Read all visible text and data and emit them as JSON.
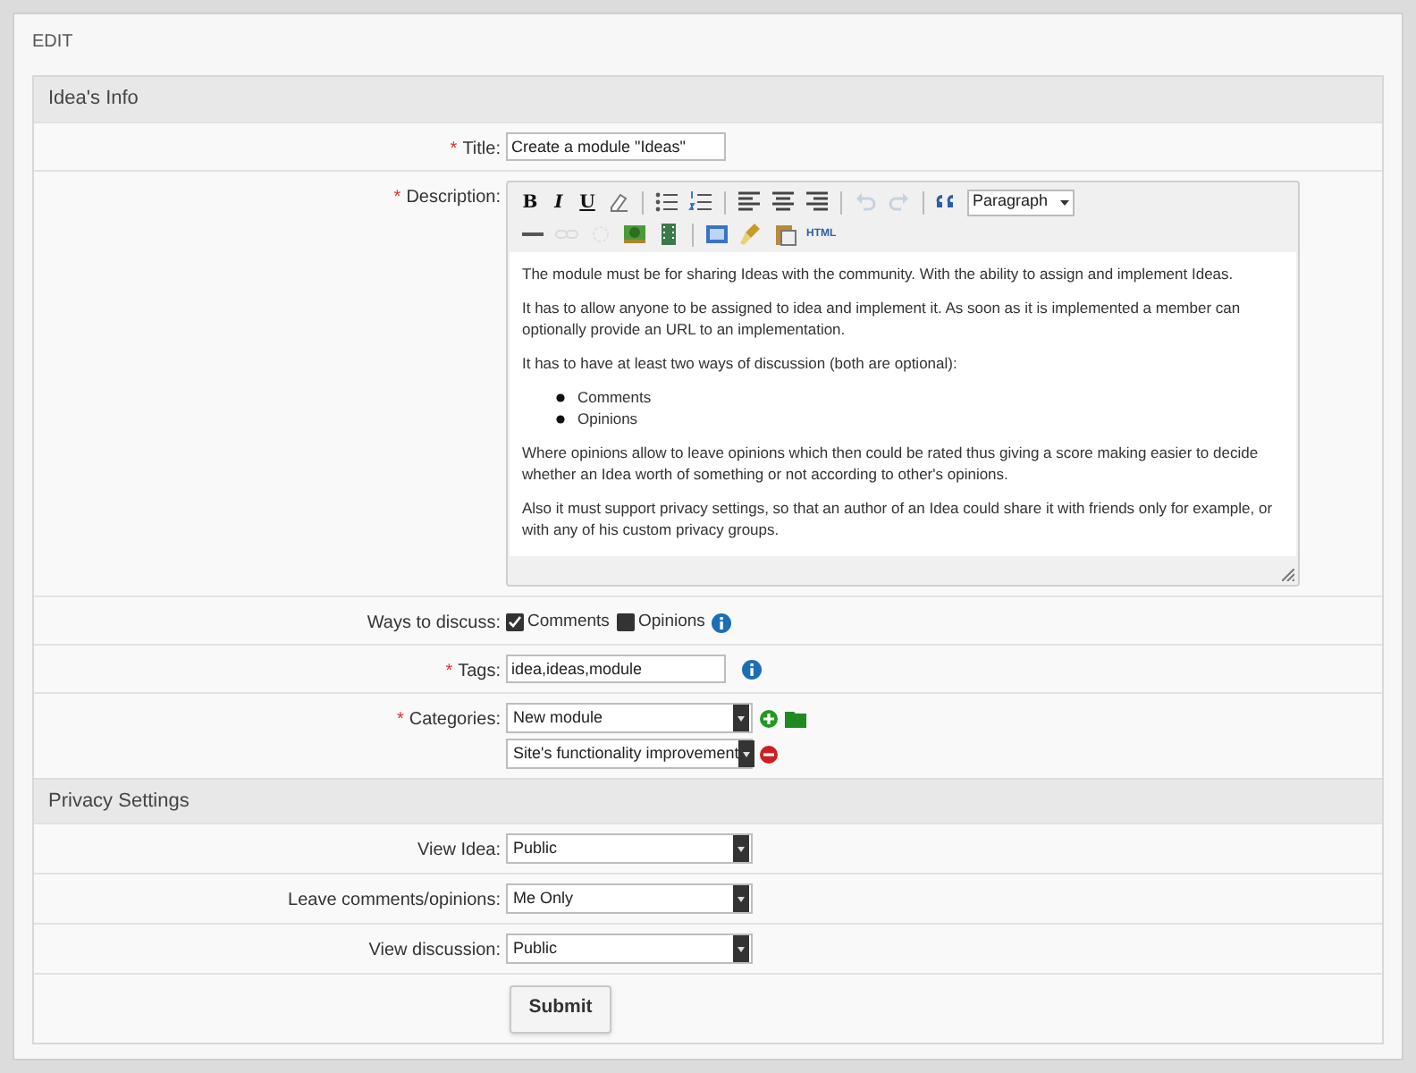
{
  "page_title": "EDIT",
  "sections": [
    {
      "title": "Idea's Info",
      "fields": [
        {
          "kind": "text",
          "label": "Title:",
          "required_mark": "*",
          "value": "Create a module \"Ideas\""
        },
        {
          "kind": "editor",
          "label": "Description:",
          "required_mark": "*",
          "toolbar": [
            [
              {
                "kind": "bold",
                "label": "B",
                "disabled": false
              },
              {
                "kind": "italic",
                "label": "I",
                "disabled": false
              },
              {
                "kind": "underline",
                "label": "U",
                "disabled": false
              },
              {
                "kind": "eraser",
                "disabled": false
              },
              {
                "kind": "sep"
              },
              {
                "kind": "bullets",
                "disabled": false
              },
              {
                "kind": "numbers",
                "disabled": false
              },
              {
                "kind": "sep"
              },
              {
                "kind": "align-left",
                "disabled": false
              },
              {
                "kind": "align-center",
                "disabled": false
              },
              {
                "kind": "align-right",
                "disabled": false
              },
              {
                "kind": "sep"
              },
              {
                "kind": "undo",
                "disabled": true
              },
              {
                "kind": "redo",
                "disabled": true
              },
              {
                "kind": "sep"
              },
              {
                "kind": "quote",
                "disabled": false
              },
              {
                "kind": "format",
                "value": "Paragraph"
              }
            ],
            [
              {
                "kind": "rule",
                "disabled": false
              },
              {
                "kind": "link",
                "disabled": true
              },
              {
                "kind": "unlink",
                "disabled": true
              },
              {
                "kind": "image",
                "disabled": false
              },
              {
                "kind": "media",
                "disabled": false
              },
              {
                "kind": "sep"
              },
              {
                "kind": "window",
                "disabled": false
              },
              {
                "kind": "clean",
                "disabled": false
              },
              {
                "kind": "paste",
                "disabled": false
              },
              {
                "kind": "html",
                "label": "HTML",
                "disabled": false
              }
            ]
          ],
          "content": [
            {
              "kind": "p",
              "text": "The module must be for sharing Ideas with the community. With the ability to assign and implement Ideas."
            },
            {
              "kind": "p",
              "text": "It has to allow anyone to be assigned to idea and implement it. As soon as it is implemented a member can optionally provide an URL to an implementation."
            },
            {
              "kind": "p",
              "text": "It has to have at least two ways of discussion (both are optional):"
            },
            {
              "kind": "ul",
              "items": [
                "Comments",
                "Opinions"
              ]
            },
            {
              "kind": "p",
              "text": "Where opinions allow to leave opinions which then could be rated thus giving a score making easier to decide whether an Idea worth of something or not according to other's opinions."
            },
            {
              "kind": "p",
              "text": "Also it must support privacy settings, so that an author of an Idea could share it with friends only for example, or with any of his custom privacy groups."
            }
          ]
        },
        {
          "kind": "checkboxes",
          "label": "Ways to discuss:",
          "info": true,
          "options": [
            {
              "label": "Comments",
              "checked": true
            },
            {
              "label": "Opinions",
              "checked": false
            }
          ]
        },
        {
          "kind": "text",
          "label": "Tags:",
          "required_mark": "*",
          "value": "idea,ideas,module",
          "info": true
        },
        {
          "kind": "categories",
          "label": "Categories:",
          "required_mark": "*",
          "items": [
            {
              "value": "New module",
              "kind": "add"
            },
            {
              "value": "Site's functionality improvement",
              "kind": "remove"
            }
          ]
        }
      ]
    },
    {
      "title": "Privacy Settings",
      "fields": [
        {
          "kind": "select",
          "label": "View Idea:",
          "value": "Public"
        },
        {
          "kind": "select",
          "label": "Leave comments/opinions:",
          "value": "Me Only"
        },
        {
          "kind": "select",
          "label": "View discussion:",
          "value": "Public"
        },
        {
          "kind": "submit",
          "label": "Submit"
        }
      ]
    }
  ]
}
